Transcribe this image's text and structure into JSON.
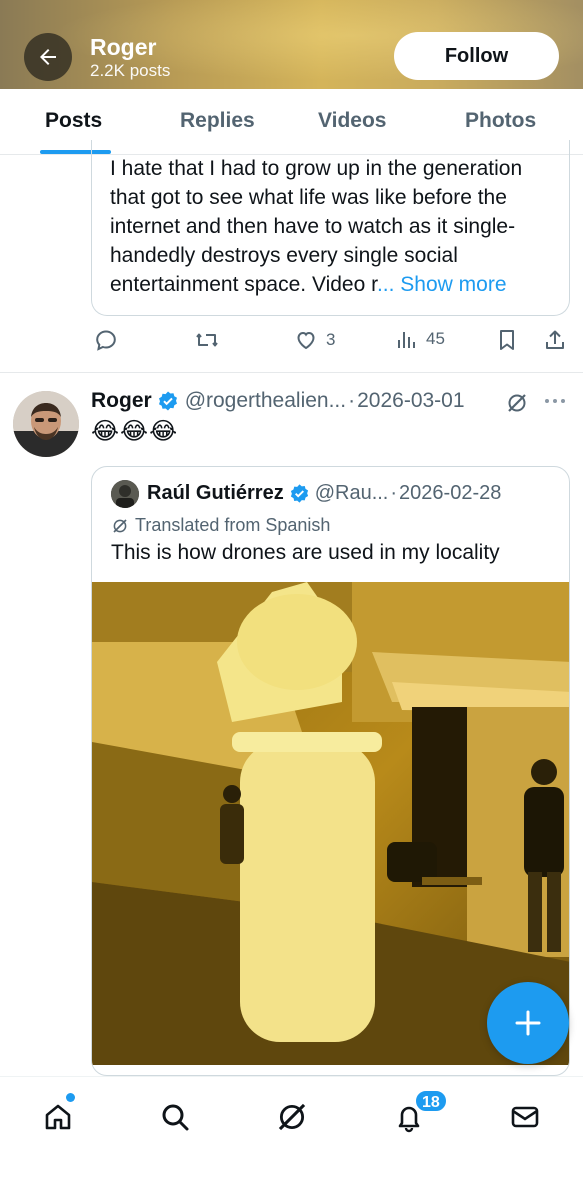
{
  "header": {
    "name": "Roger",
    "posts_count": "2.2K posts",
    "follow_label": "Follow",
    "back_icon": "arrow-left-icon"
  },
  "tabs": [
    {
      "label": "Posts",
      "active": true
    },
    {
      "label": "Replies",
      "active": false
    },
    {
      "label": "Videos",
      "active": false
    },
    {
      "label": "Photos",
      "active": false
    }
  ],
  "previous_post": {
    "quoted_text": "I hate that I had to grow up in the generation that got to see what life was like before the internet and then have to watch as it single-handedly destroys every single social entertainment space. Video r",
    "show_more": "... Show more",
    "actions": {
      "reply": "",
      "repost": "",
      "like": "3",
      "views": "45"
    }
  },
  "post": {
    "name": "Roger",
    "handle": "@rogerthealien...",
    "separator": "·",
    "date": "2026-03-01",
    "text": "😂😂😂",
    "quote": {
      "name": "Raúl Gutiérrez",
      "handle": "@Rau...",
      "separator": "·",
      "date": "2026-02-28",
      "translated": "Translated from Spanish",
      "text": "This is how drones are used in my locality"
    }
  },
  "bottom_nav": {
    "notifications_badge": "18",
    "items": [
      "home-icon",
      "search-icon",
      "grok-icon",
      "notifications-icon",
      "messages-icon"
    ]
  },
  "colors": {
    "accent": "#1d9bf0",
    "text": "#0f1419",
    "muted": "#536471",
    "border": "#cfd9de"
  }
}
